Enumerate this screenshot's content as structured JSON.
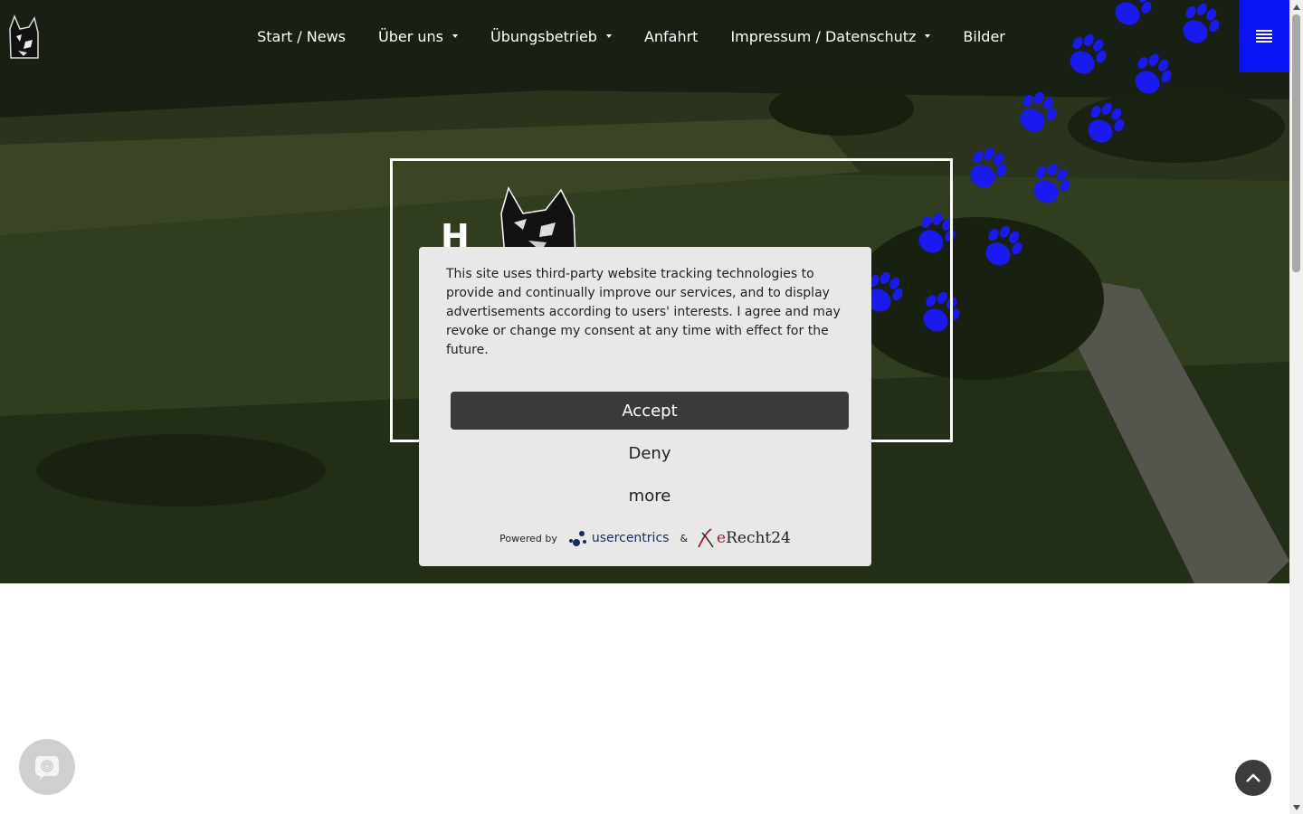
{
  "nav": {
    "items": [
      {
        "label": "Start / News",
        "has_dropdown": false
      },
      {
        "label": "Über uns",
        "has_dropdown": true
      },
      {
        "label": "Übungsbetrieb",
        "has_dropdown": true
      },
      {
        "label": "Anfahrt",
        "has_dropdown": false
      },
      {
        "label": "Impressum / Datenschutz",
        "has_dropdown": true
      },
      {
        "label": "Bilder",
        "has_dropdown": false
      }
    ],
    "menu_button_color": "#0a14f5"
  },
  "hero": {
    "frame_letter": "H",
    "paw_color": "#1a1af0"
  },
  "consent": {
    "text": "This site uses third-party website tracking technologies to provide and continually improve our services, and to display advertisements according to users' interests. I agree and may revoke or change my consent at any time with effect for the future.",
    "accept_label": "Accept",
    "deny_label": "Deny",
    "more_label": "more",
    "powered_by": "Powered by",
    "usercentrics": "usercentrics",
    "ampersand": "&",
    "erecht_e": "e",
    "erecht_rest": "Recht24"
  },
  "icons": {
    "menu": "hamburger-icon",
    "chat": "fingerprint-icon",
    "scroll_top": "chevron-up-icon"
  }
}
